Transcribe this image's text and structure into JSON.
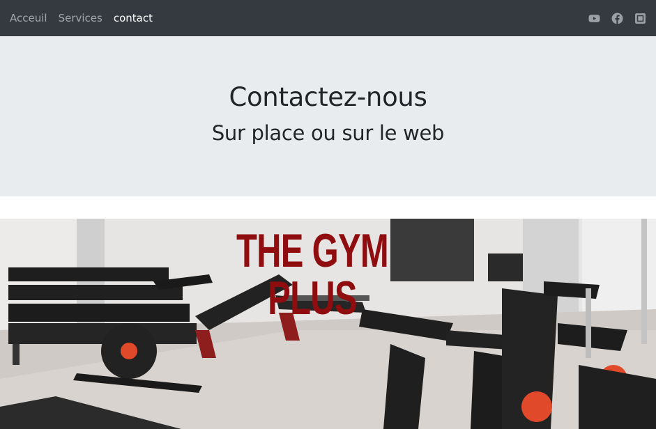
{
  "nav": {
    "links": [
      "Acceuil",
      "Services",
      "contact"
    ],
    "active_index": 2,
    "social_icons": [
      "youtube-icon",
      "facebook-icon",
      "instagram-icon"
    ]
  },
  "hero": {
    "title": "Contactez-nous",
    "subtitle": "Sur place ou sur le web"
  },
  "banner": {
    "logo_text": "THE GYM PLUS",
    "logo_color": "#8f0d0f"
  },
  "colors": {
    "navbar_bg": "#343a40",
    "hero_bg": "#e9ecef"
  }
}
